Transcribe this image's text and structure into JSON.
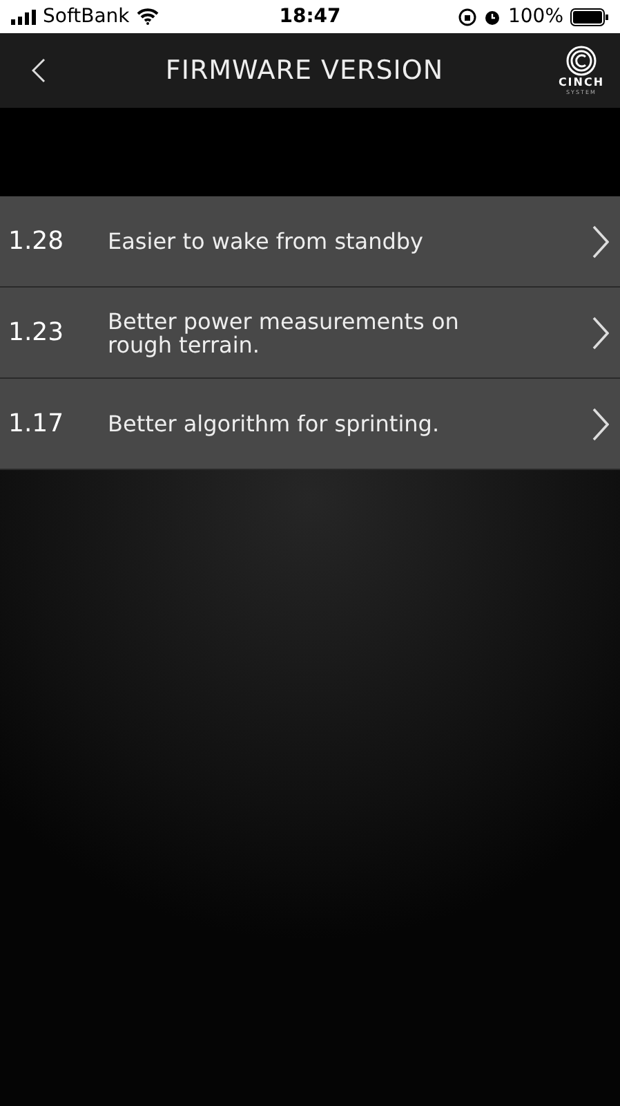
{
  "status_bar": {
    "carrier": "SoftBank",
    "time": "18:47",
    "battery": "100%"
  },
  "header": {
    "title": "FIRMWARE VERSION",
    "logo": {
      "name": "CINCH",
      "tagline": "SYSTEM"
    }
  },
  "versions": [
    {
      "version": "1.28",
      "note": "Easier to wake from standby"
    },
    {
      "version": "1.23",
      "note": "Better power measurements on rough terrain."
    },
    {
      "version": "1.17",
      "note": "Better algorithm for sprinting."
    }
  ]
}
